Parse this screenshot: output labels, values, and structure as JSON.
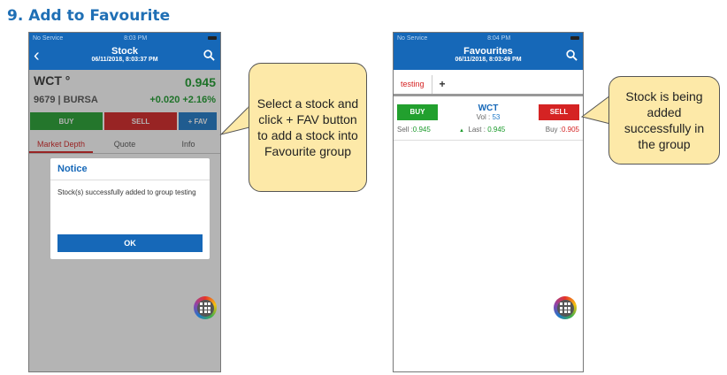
{
  "heading": "9. Add to Favourite",
  "left_phone": {
    "status": {
      "carrier": "No Service",
      "time": "8:03 PM"
    },
    "nav": {
      "title": "Stock",
      "subtitle": "06/11/2018, 8:03:37 PM"
    },
    "stock": {
      "code": "WCT °",
      "price": "0.945",
      "id_exchange": "9679 | BURSA",
      "change": "+0.020 +2.16%"
    },
    "actions": {
      "buy": "BUY",
      "sell": "SELL",
      "fav": "+ FAV"
    },
    "tabs": [
      "Market Depth",
      "Quote",
      "Info"
    ],
    "dialog": {
      "title": "Notice",
      "message": "Stock(s) successfully added to group testing",
      "ok": "OK"
    }
  },
  "right_phone": {
    "status": {
      "carrier": "No Service",
      "time": "8:04 PM"
    },
    "nav": {
      "title": "Favourites",
      "subtitle": "06/11/2018, 8:03:49 PM"
    },
    "tabs": {
      "active": "testing",
      "add": "+"
    },
    "row": {
      "buy": "BUY",
      "sell": "SELL",
      "code": "WCT",
      "vol_label": "Vol :",
      "vol": "53",
      "sell_label": "Sell :",
      "sell_price": "0.945",
      "last_label": "Last :",
      "last_price": "0.945",
      "buy_label": "Buy :",
      "buy_price": "0.905"
    }
  },
  "callouts": {
    "left": "Select a stock and click + FAV button to add a stock into Favourite group",
    "right": "Stock is being added successfully in the group"
  },
  "colors": {
    "brand_blue": "#1668b8",
    "buy_green": "#22a02e",
    "sell_red": "#d52323",
    "callout_fill": "#fde9a8"
  }
}
